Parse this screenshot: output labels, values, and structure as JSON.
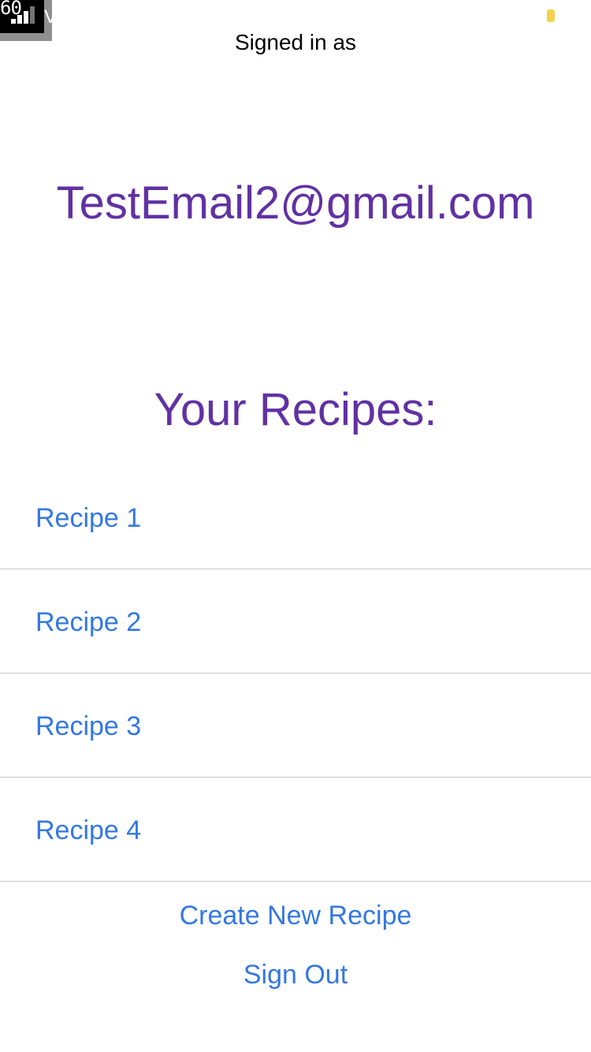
{
  "status_bar": {
    "fps_text": "60",
    "carrier_text": "V",
    "signal_icon": "cellular-signal-icon",
    "battery_icon": "battery-icon",
    "battery_color": "#f4d24a"
  },
  "header": {
    "signed_in_label": "Signed in as",
    "email": "TestEmail2@gmail.com"
  },
  "recipes": {
    "heading": "Your Recipes:",
    "items": [
      {
        "label": "Recipe 1"
      },
      {
        "label": "Recipe 2"
      },
      {
        "label": "Recipe 3"
      },
      {
        "label": "Recipe 4"
      }
    ]
  },
  "actions": {
    "create_label": "Create New Recipe",
    "sign_out_label": "Sign Out"
  },
  "colors": {
    "accent_purple": "#6131a3",
    "link_blue": "#3478e0",
    "divider": "#c8c8c8"
  }
}
